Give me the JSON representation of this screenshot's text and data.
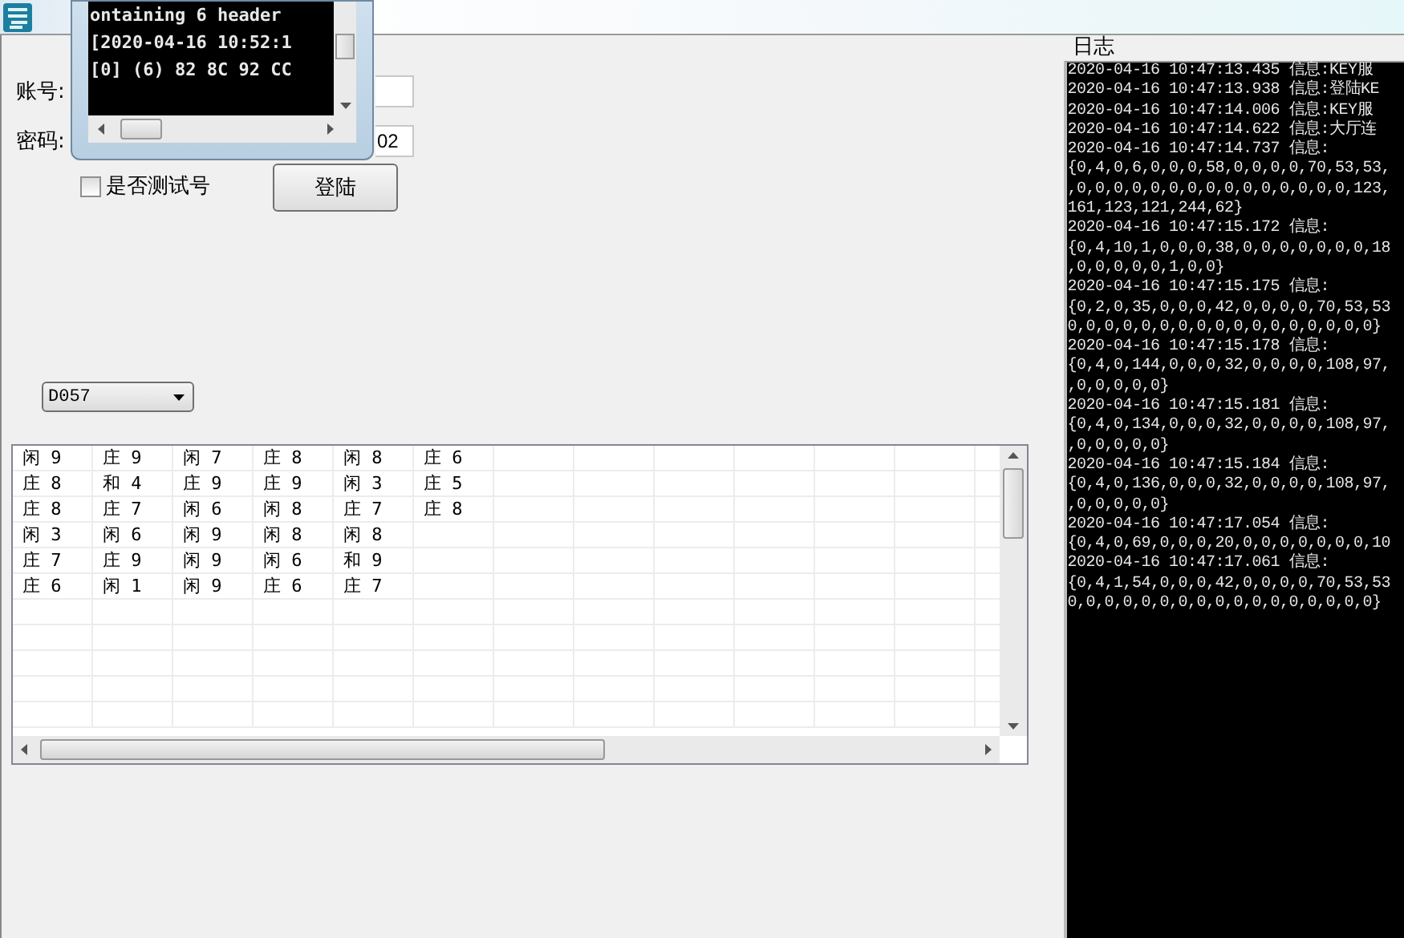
{
  "form": {
    "account": {
      "label": "账号:"
    },
    "password": {
      "label": "密码:",
      "value": "02"
    },
    "test_account": {
      "label": "是否测试号",
      "checked": false
    },
    "login_button": "登陆",
    "table_dropdown": {
      "value": "D057"
    }
  },
  "results_table": {
    "rows": [
      [
        "闲 9",
        "庄 9",
        "闲 7",
        "庄 8",
        "闲 8",
        "庄 6"
      ],
      [
        "庄 8",
        "和 4",
        "庄 9",
        "庄 9",
        "闲 3",
        "庄 5"
      ],
      [
        "庄 8",
        "庄 7",
        "闲 6",
        "闲 8",
        "庄 7",
        "庄 8"
      ],
      [
        "闲 3",
        "闲 6",
        "闲 9",
        "闲 8",
        "闲 8"
      ],
      [
        "庄 7",
        "庄 9",
        "闲 9",
        "闲 6",
        "和 9"
      ],
      [
        "庄 6",
        "闲 1",
        "闲 9",
        "庄 6",
        "庄 7"
      ]
    ]
  },
  "console_window": {
    "lines": [
      "ontaining 6 header",
      "[2020-04-16 10:52:1",
      "[0] (6) 82 8C 92 CC"
    ]
  },
  "log": {
    "title": "日志",
    "lines": [
      "2020-04-16 10:47:13.435 信息:KEY服",
      "2020-04-16 10:47:13.938 信息:登陆KE",
      "2020-04-16 10:47:14.006 信息:KEY服",
      "2020-04-16 10:47:14.622 信息:大厅连",
      "2020-04-16 10:47:14.737 信息:",
      "{0,4,0,6,0,0,0,58,0,0,0,0,70,53,53,",
      ",0,0,0,0,0,0,0,0,0,0,0,0,0,0,0,123,",
      "161,123,121,244,62}",
      "2020-04-16 10:47:15.172 信息:",
      "{0,4,10,1,0,0,0,38,0,0,0,0,0,0,0,18",
      ",0,0,0,0,0,1,0,0}",
      "2020-04-16 10:47:15.175 信息:",
      "{0,2,0,35,0,0,0,42,0,0,0,0,70,53,53",
      "0,0,0,0,0,0,0,0,0,0,0,0,0,0,0,0,0}",
      "2020-04-16 10:47:15.178 信息:",
      "{0,4,0,144,0,0,0,32,0,0,0,0,108,97,",
      ",0,0,0,0,0}",
      "2020-04-16 10:47:15.181 信息:",
      "{0,4,0,134,0,0,0,32,0,0,0,0,108,97,",
      ",0,0,0,0,0}",
      "2020-04-16 10:47:15.184 信息:",
      "{0,4,0,136,0,0,0,32,0,0,0,0,108,97,",
      ",0,0,0,0,0}",
      "2020-04-16 10:47:17.054 信息:",
      "{0,4,0,69,0,0,0,20,0,0,0,0,0,0,0,10",
      "2020-04-16 10:47:17.061 信息:",
      "{0,4,1,54,0,0,0,42,0,0,0,0,70,53,53",
      "0,0,0,0,0,0,0,0,0,0,0,0,0,0,0,0,0}"
    ]
  }
}
